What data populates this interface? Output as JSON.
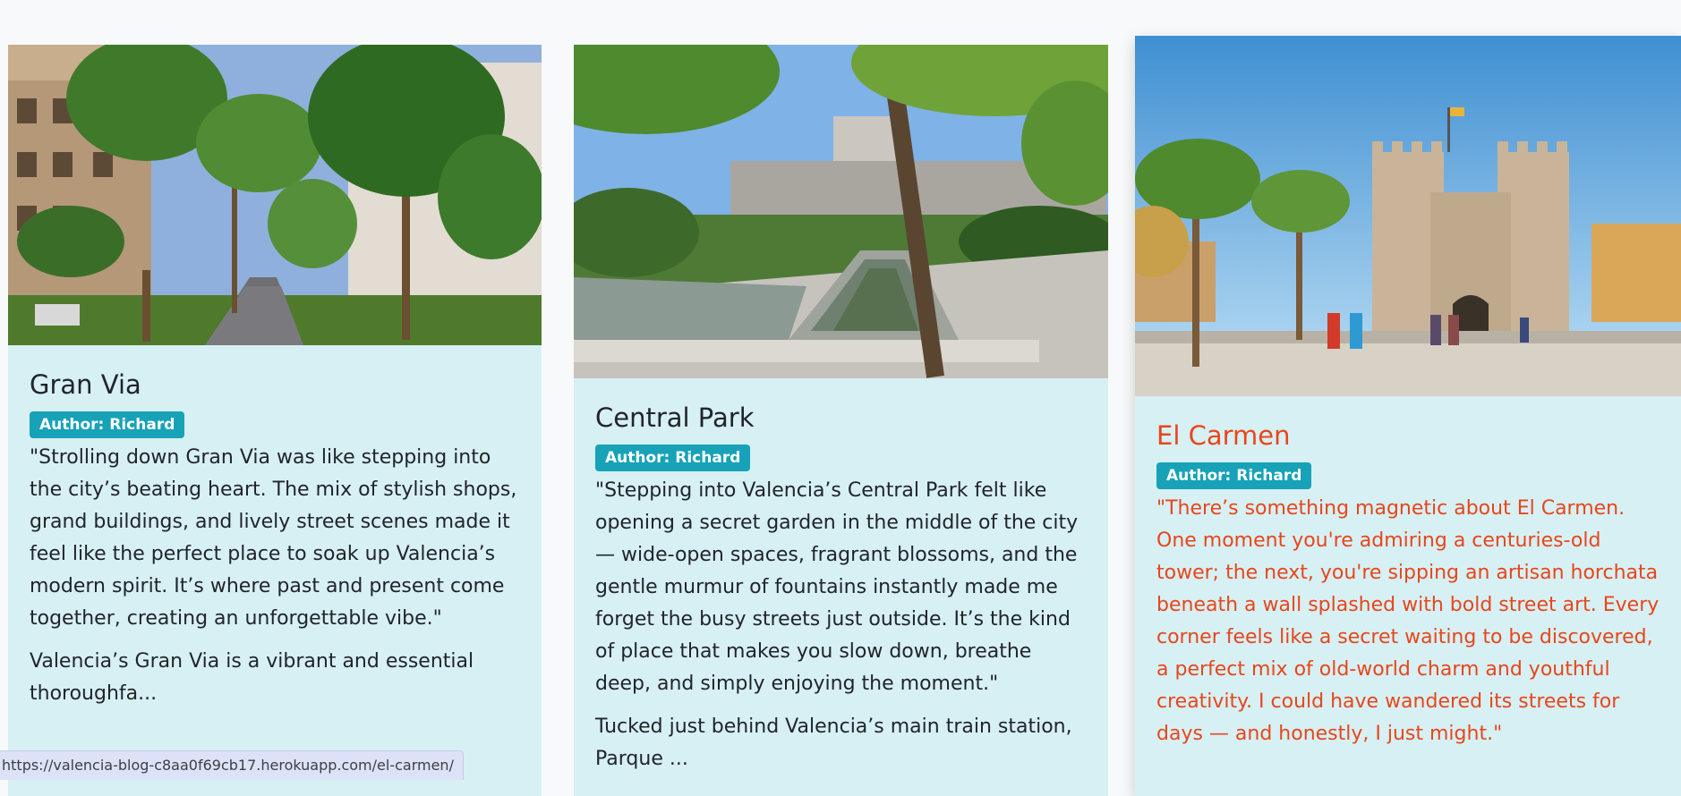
{
  "cards": [
    {
      "title": "Gran Via",
      "author": "Author: Richard",
      "quote": "\"Strolling down Gran Via was like stepping into the city’s beating heart. The mix of stylish shops, grand buildings, and lively street scenes made it feel like the perfect place to soak up Valencia’s modern spirit. It’s where past and present come together, creating an unforgettable vibe.\"",
      "excerpt": "Valencia’s Gran Via is a vibrant and essential thoroughfa...",
      "image": "street-with-palm-trees-photo"
    },
    {
      "title": "Central Park",
      "author": "Author: Richard",
      "quote": "\"Stepping into Valencia’s Central Park felt like opening a secret garden in the middle of the city — wide-open spaces, fragrant blossoms, and the gentle murmur of fountains instantly made me forget the busy streets just outside. It’s the kind of place that makes you slow down, breathe deep, and simply enjoying the moment.\"",
      "excerpt": "Tucked just behind Valencia’s main train station, Parque ...",
      "image": "park-with-water-channel-photo"
    },
    {
      "title": "El Carmen",
      "author": "Author: Richard",
      "quote": "\"There’s something magnetic about El Carmen. One moment you're admiring a centuries-old tower; the next, you're sipping an artisan horchata beneath a wall splashed with bold street art. Every corner feels like a secret waiting to be discovered, a perfect mix of old-world charm and youthful creativity. I could have wandered its streets for days — and honestly, I just might.\"",
      "excerpt": "",
      "image": "medieval-city-gate-towers-photo"
    }
  ],
  "status_url": "https://valencia-blog-c8aa0f69cb17.herokuapp.com/el-carmen/",
  "colors": {
    "card_bg": "#d7f0f4",
    "badge_bg": "#17a2b8",
    "hover_accent": "#e8461b",
    "text": "#212529"
  }
}
